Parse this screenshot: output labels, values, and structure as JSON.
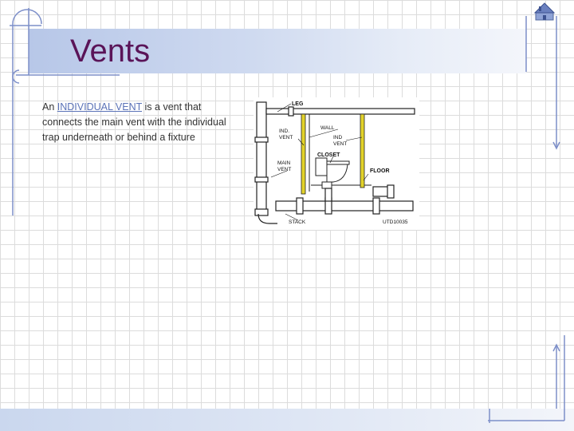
{
  "title": "Vents",
  "body": {
    "prefix": "An ",
    "link": "INDIVIDUAL VENT",
    "suffix": " is a vent that connects the main vent with the individual trap underneath or behind a fixture"
  },
  "diagram": {
    "labels": {
      "leg": "LEG",
      "ind_vent_left_1": "IND.",
      "ind_vent_left_2": "VENT",
      "wall": "WALL",
      "ind_vent_right_1": "IND",
      "ind_vent_right_2": "VENT",
      "closet": "CLOSET",
      "main_vent_1": "MAIN",
      "main_vent_2": "VENT",
      "floor": "FLOOR",
      "stack": "STACK",
      "code": "UTD10035"
    }
  },
  "icons": {
    "home": "home-icon"
  },
  "colors": {
    "title": "#5a1458",
    "link": "#5b73b8",
    "frame_line": "#7d8fc9",
    "title_band": "#b7c7e8",
    "vent_pipe": "#e2d22a"
  }
}
